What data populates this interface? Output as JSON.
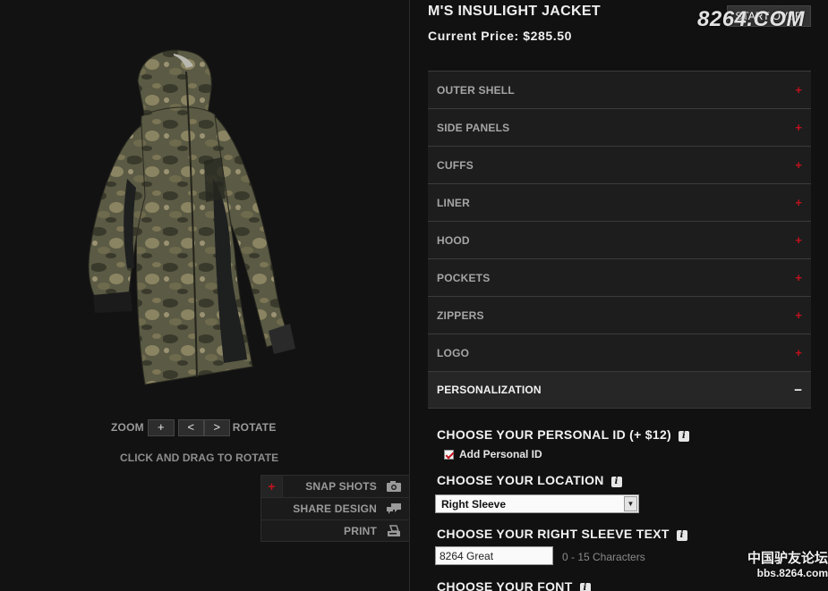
{
  "product": {
    "title": "M'S INSULIGHT JACKET",
    "price": "Current Price: $285.50",
    "start_over": "START OVER"
  },
  "watermark": {
    "site": "8264.COM",
    "corner_line1": "中国驴友论坛",
    "corner_line2": "bbs.8264.com"
  },
  "viewer": {
    "zoom_label": "ZOOM",
    "zoom_in": "+",
    "rotate_left": "<",
    "rotate_right": ">",
    "rotate_label": "ROTATE",
    "drag_hint": "CLICK AND DRAG TO ROTATE",
    "jacket_colors": {
      "camo_base": "#5b5a44",
      "camo_dark": "#3a3a2c",
      "camo_light": "#8a8462",
      "panel": "#1e1f1f"
    }
  },
  "tools": [
    {
      "label": "SNAP SHOTS",
      "icon": "camera-icon",
      "expand": "+"
    },
    {
      "label": "SHARE DESIGN",
      "icon": "speech-bubbles-icon"
    },
    {
      "label": "PRINT",
      "icon": "printer-icon"
    }
  ],
  "accordion": [
    {
      "label": "OUTER SHELL",
      "sign": "+"
    },
    {
      "label": "SIDE PANELS",
      "sign": "+"
    },
    {
      "label": "CUFFS",
      "sign": "+"
    },
    {
      "label": "LINER",
      "sign": "+"
    },
    {
      "label": "HOOD",
      "sign": "+"
    },
    {
      "label": "POCKETS",
      "sign": "+"
    },
    {
      "label": "ZIPPERS",
      "sign": "+"
    },
    {
      "label": "LOGO",
      "sign": "+"
    },
    {
      "label": "PERSONALIZATION",
      "sign": "−",
      "open": true
    }
  ],
  "personalization": {
    "id_heading": "CHOOSE YOUR PERSONAL ID (+ $12)",
    "add_id_label": "Add Personal ID",
    "add_id_checked": true,
    "location_heading": "CHOOSE YOUR LOCATION",
    "location_value": "Right Sleeve",
    "text_heading": "CHOOSE YOUR RIGHT SLEEVE TEXT",
    "text_value": "8264 Great",
    "char_hint": "0 - 15 Characters",
    "font_heading": "CHOOSE YOUR FONT",
    "info_glyph": "i"
  },
  "colors": {
    "accent_red": "#c1121d",
    "panel_bg": "#1d1d1d",
    "page_bg": "#111111"
  }
}
